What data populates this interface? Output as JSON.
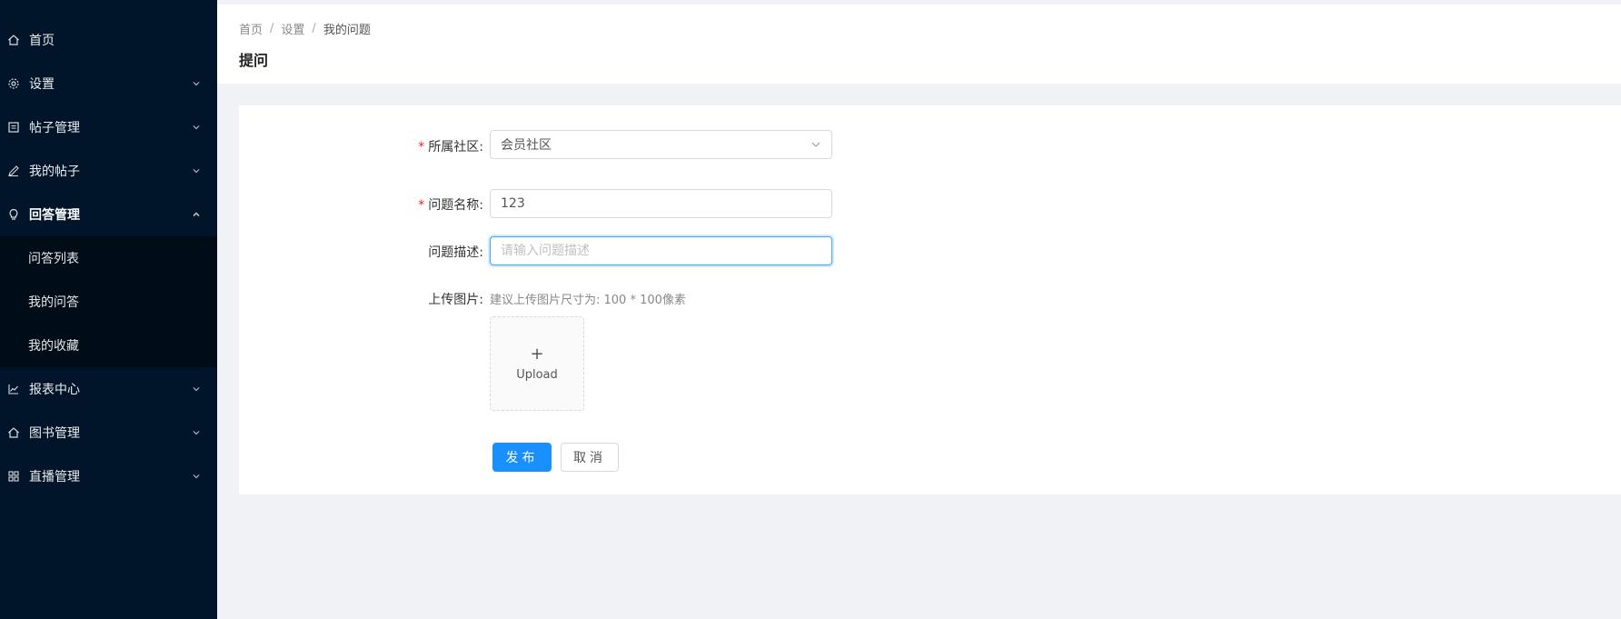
{
  "sidebar": {
    "items": [
      {
        "label": "首页",
        "icon": "home-icon"
      },
      {
        "label": "设置",
        "icon": "gear-icon"
      },
      {
        "label": "帖子管理",
        "icon": "document-icon"
      },
      {
        "label": "我的帖子",
        "icon": "edit-icon"
      },
      {
        "label": "回答管理",
        "icon": "bulb-icon"
      },
      {
        "label": "报表中心",
        "icon": "line-chart-icon"
      },
      {
        "label": "图书管理",
        "icon": "home-icon"
      },
      {
        "label": "直播管理",
        "icon": "grid-icon"
      }
    ],
    "submenu": [
      "问答列表",
      "我的问答",
      "我的收藏"
    ]
  },
  "header": {
    "breadcrumb": [
      "首页",
      "设置",
      "我的问题"
    ],
    "separator": "/",
    "title": "提问"
  },
  "form": {
    "community": {
      "label": "所属社区:",
      "value": "会员社区",
      "required": true
    },
    "question_name": {
      "label": "问题名称:",
      "value": "123",
      "required": true
    },
    "description": {
      "label": "问题描述:",
      "placeholder": "请输入问题描述"
    },
    "upload": {
      "label": "上传图片:",
      "hint": "建议上传图片尺寸为: 100 * 100像素",
      "plus": "+",
      "text": "Upload"
    },
    "submit_label": "发布",
    "cancel_label": "取消",
    "required_mark": "*"
  },
  "colors": {
    "sidebar_bg": "#001529",
    "submenu_bg": "#000c17",
    "primary": "#1890ff",
    "required": "#f5222d",
    "page_bg": "#f0f2f5"
  }
}
